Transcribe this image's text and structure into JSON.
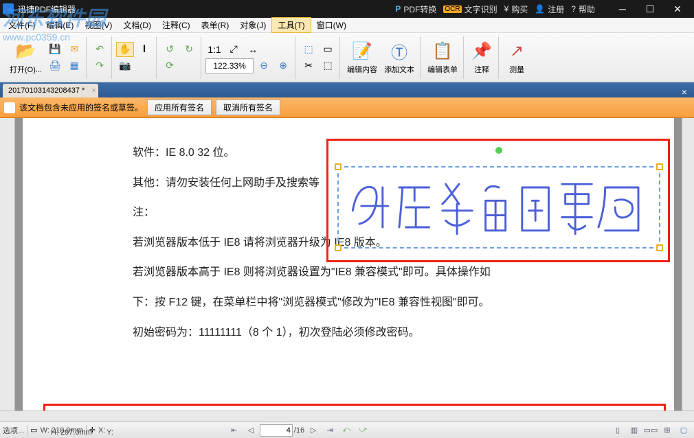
{
  "titlebar": {
    "title": "迅捷PDF编辑器",
    "pdf_convert": "PDF转换",
    "ocr": "文字识别",
    "buy": "购买",
    "register": "注册",
    "help": "帮助"
  },
  "menu": {
    "file": "文件(F)",
    "edit": "编辑(E)",
    "view": "视图(V)",
    "doc": "文档(D)",
    "comment": "注释(C)",
    "form": "表单(R)",
    "object": "对象(J)",
    "tool": "工具(T)",
    "window": "窗口(W)"
  },
  "toolbar": {
    "open": "打开(O)...",
    "zoom": "122.33%",
    "edit_content": "编辑内容",
    "add_text": "添加文本",
    "edit_form": "编辑表单",
    "annotate": "注释",
    "measure": "测量"
  },
  "tab": {
    "name": "20170103143208437 *"
  },
  "notice": {
    "text": "该文档包含未应用的签名或草签。",
    "apply": "应用所有签名",
    "cancel": "取消所有签名"
  },
  "doc": {
    "l1": "软件：IE 8.0 32 位。",
    "l2": "其他：请勿安装任何上网助手及搜索等",
    "l3": "注：",
    "l4": "若浏览器版本低于 IE8 请将浏览器升级为 IE8 版本。",
    "l5": "若浏览器版本高于 IE8 则将浏览器设置为\"IE8 兼容模式\"即可。具体操作如",
    "l6": "下：按 F12 键，在菜单栏中将\"浏览器模式\"修改为\"IE8 兼容性视图\"即可。",
    "l7": "初始密码为：11111111（8 个 1），初次登陆必须修改密码。"
  },
  "status": {
    "options": "选项...",
    "w_label": "W:",
    "w_val": "210.0mm",
    "h_label": "H:",
    "h_val": "297.0mm",
    "x_label": "X:",
    "y_label": "Y:",
    "page_cur": "4",
    "page_total": "/16"
  },
  "watermark": {
    "brand": "河东软件园",
    "url": "www.pc0359.cn"
  }
}
